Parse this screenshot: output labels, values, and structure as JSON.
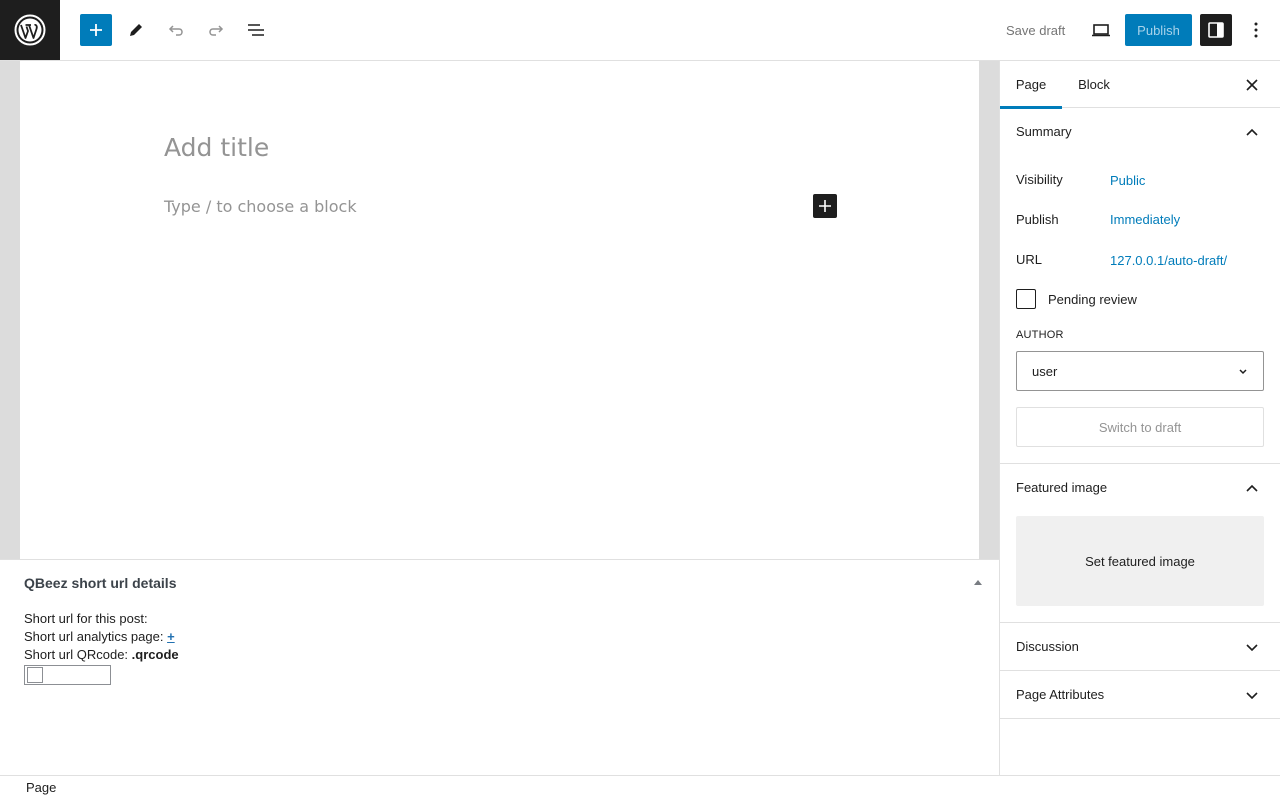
{
  "toolbar": {
    "save_draft": "Save draft",
    "publish": "Publish"
  },
  "editor": {
    "title_placeholder": "Add title",
    "block_placeholder": "Type / to choose a block"
  },
  "metabox": {
    "title": "QBeez short url details",
    "line1": "Short url for this post:",
    "line2_prefix": "Short url analytics page: ",
    "line2_link": "+",
    "line3_prefix": "Short url QRcode: ",
    "line3_value": ".qrcode"
  },
  "footer": {
    "breadcrumb": "Page"
  },
  "sidebar": {
    "tabs": [
      "Page",
      "Block"
    ],
    "summary": {
      "title": "Summary",
      "visibility_label": "Visibility",
      "visibility_value": "Public",
      "publish_label": "Publish",
      "publish_value": "Immediately",
      "url_label": "URL",
      "url_value": "127.0.0.1/auto-draft/",
      "pending_review": "Pending review",
      "author_label": "AUTHOR",
      "author_value": "user",
      "switch_to_draft": "Switch to draft"
    },
    "featured_image": {
      "title": "Featured image",
      "button": "Set featured image"
    },
    "discussion": {
      "title": "Discussion"
    },
    "page_attributes": {
      "title": "Page Attributes"
    }
  },
  "colors": {
    "accent": "#007cba",
    "dark": "#1e1e1e",
    "border": "#e0e0e0",
    "canvas_bg": "#dcdcdc"
  }
}
